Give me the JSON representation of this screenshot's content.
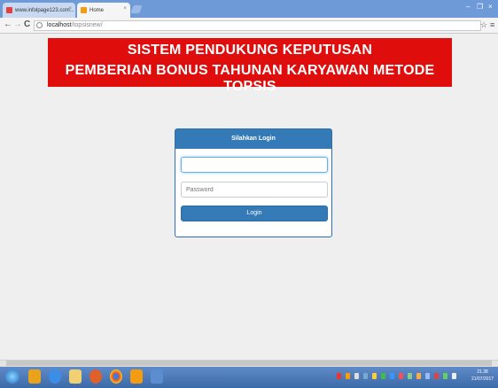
{
  "browser": {
    "tabs": [
      {
        "label": "www.infolpage123.com...",
        "active": false
      },
      {
        "label": "Home",
        "active": true
      }
    ],
    "address": {
      "host": "localhost",
      "path": "/topsisnew/"
    }
  },
  "header": {
    "line1": "SISTEM PENDUKUNG KEPUTUSAN",
    "line2": "PEMBERIAN BONUS TAHUNAN KARYAWAN METODE TOPSIS"
  },
  "login": {
    "title": "Silahkan Login",
    "username_value": "",
    "password_placeholder": "Password",
    "button_label": "Login"
  },
  "taskbar": {
    "time": "21.38",
    "date": "21/07/2017"
  },
  "colors": {
    "banner": "#e00d0d",
    "primary": "#337ab7",
    "page_bg": "#efefef"
  }
}
